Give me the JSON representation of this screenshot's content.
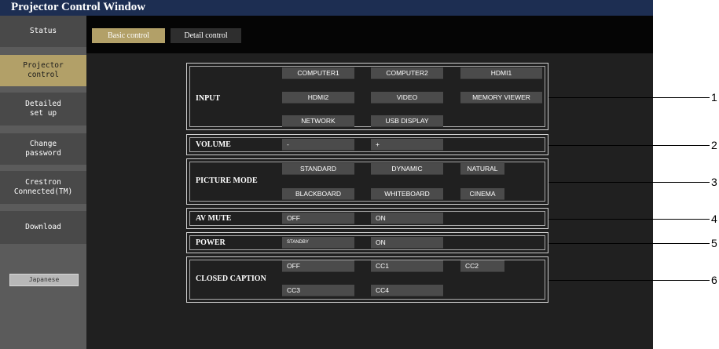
{
  "window": {
    "title": "Projector Control Window"
  },
  "sidebar": {
    "items": [
      {
        "label": "Status"
      },
      {
        "label": "Projector\ncontrol"
      },
      {
        "label": "Detailed\nset up"
      },
      {
        "label": "Change\npassword"
      },
      {
        "label": "Crestron\nConnected(TM)"
      },
      {
        "label": "Download"
      }
    ],
    "language_button": "Japanese",
    "active_item": "Projector control"
  },
  "tabs": [
    {
      "label": "Basic control",
      "active": true
    },
    {
      "label": "Detail control",
      "active": false
    }
  ],
  "panels": {
    "input": {
      "label": "INPUT",
      "buttons": [
        "COMPUTER1",
        "COMPUTER2",
        "HDMI1",
        "HDMI2",
        "VIDEO",
        "MEMORY VIEWER",
        "NETWORK",
        "USB DISPLAY"
      ]
    },
    "volume": {
      "label": "VOLUME",
      "buttons": [
        "-",
        "+"
      ]
    },
    "picture_mode": {
      "label": "PICTURE MODE",
      "buttons": [
        "STANDARD",
        "DYNAMIC",
        "NATURAL",
        "BLACKBOARD",
        "WHITEBOARD",
        "CINEMA"
      ]
    },
    "av_mute": {
      "label": "AV MUTE",
      "buttons": [
        "OFF",
        "ON"
      ]
    },
    "power": {
      "label": "POWER",
      "buttons": [
        "STANDBY",
        "ON"
      ]
    },
    "closed_caption": {
      "label": "CLOSED CAPTION",
      "buttons": [
        "OFF",
        "CC1",
        "CC2",
        "CC3",
        "CC4"
      ]
    }
  },
  "callouts": [
    "1",
    "2",
    "3",
    "4",
    "5",
    "6"
  ],
  "colors": {
    "title_bar": "#1d2e52",
    "active_accent": "#b2a068",
    "sidebar": "#494949",
    "content_bg": "#202020",
    "button": "#4b4b4b"
  }
}
